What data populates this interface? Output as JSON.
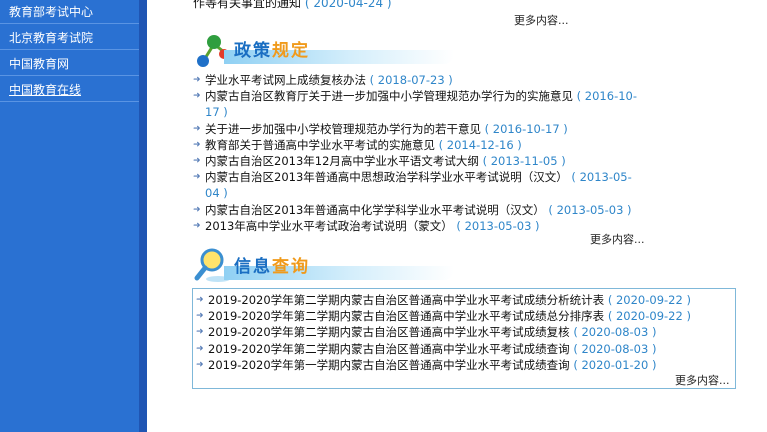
{
  "sidebar": {
    "items": [
      {
        "label": "教育部考试中心"
      },
      {
        "label": "北京教育考试院"
      },
      {
        "label": "中国教育网"
      },
      {
        "label": "中国教育在线"
      }
    ]
  },
  "top_news": {
    "text": "作等有关事宜的通知",
    "date": "( 2020-04-24 )"
  },
  "more_label": "更多内容...",
  "policy": {
    "title_part1": "政策",
    "title_part2": "规定",
    "items": [
      {
        "text": "学业水平考试网上成绩复核办法",
        "date": "( 2018-07-23 )"
      },
      {
        "text": "内蒙古自治区教育厅关于进一步加强中小学管理规范办学行为的实施意见",
        "date": "( 2016-10-17 )"
      },
      {
        "text": "关于进一步加强中小学校管理规范办学行为的若干意见",
        "date": "( 2016-10-17 )"
      },
      {
        "text": "教育部关于普通高中学业水平考试的实施意见",
        "date": "( 2014-12-16 )"
      },
      {
        "text": "内蒙古自治区2013年12月高中学业水平语文考试大纲",
        "date": "( 2013-11-05 )"
      },
      {
        "text": "内蒙古自治区2013年普通高中思想政治学科学业水平考试说明（汉文）",
        "date": "( 2013-05-04 )"
      },
      {
        "text": "内蒙古自治区2013年普通高中化学学科学业水平考试说明（汉文）",
        "date": "( 2013-05-03 )"
      },
      {
        "text": "2013年高中学业水平考试政治考试说明（蒙文）",
        "date": "( 2013-05-03 )"
      }
    ]
  },
  "info": {
    "title_part1": "信息",
    "title_part2": "查询",
    "items": [
      {
        "text": "2019-2020学年第二学期内蒙古自治区普通高中学业水平考试成绩分析统计表",
        "date": "( 2020-09-22 )"
      },
      {
        "text": "2019-2020学年第二学期内蒙古自治区普通高中学业水平考试成绩总分排序表",
        "date": "( 2020-09-22 )"
      },
      {
        "text": "2019-2020学年第二学期内蒙古自治区普通高中学业水平考试成绩复核",
        "date": "( 2020-08-03 )"
      },
      {
        "text": "2019-2020学年第二学期内蒙古自治区普通高中学业水平考试成绩查询",
        "date": "( 2020-08-03 )"
      },
      {
        "text": "2019-2020学年第一学期内蒙古自治区普通高中学业水平考试成绩查询",
        "date": "( 2020-01-20 )"
      }
    ]
  },
  "colors": {
    "sidebar": "#2a71d2",
    "date": "#2f86c9",
    "accent_orange": "#f09a1b"
  }
}
